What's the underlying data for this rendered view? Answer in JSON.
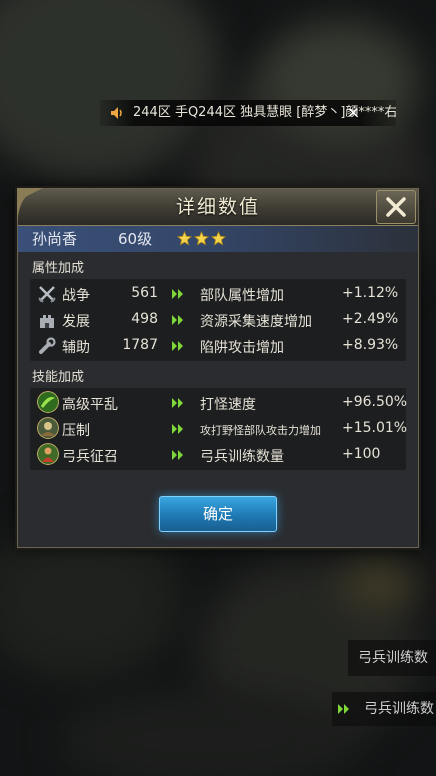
{
  "broadcast": {
    "message": "244区  手Q244区  独具慧眼  [醉梦丶]顔****右"
  },
  "dialog": {
    "title": "详细数值",
    "hero": {
      "name": "孙尚香",
      "level": "60级",
      "stars": 3
    },
    "attribute_section": {
      "title": "属性加成",
      "rows": [
        {
          "icon": "crossed-swords-icon",
          "name": "战争",
          "value": "561",
          "effect": "部队属性增加",
          "bonus": "+1.12%"
        },
        {
          "icon": "castle-icon",
          "name": "发展",
          "value": "498",
          "effect": "资源采集速度增加",
          "bonus": "+2.49%"
        },
        {
          "icon": "wrench-icon",
          "name": "辅助",
          "value": "1787",
          "effect": "陷阱攻击增加",
          "bonus": "+8.93%"
        }
      ]
    },
    "skill_section": {
      "title": "技能加成",
      "rows": [
        {
          "icon": "skill-advanced-rout-icon",
          "name": "高级平乱",
          "effect": "打怪速度",
          "bonus": "+96.50%"
        },
        {
          "icon": "skill-suppress-icon",
          "name": "压制",
          "effect": "攻打野怪部队攻击力增加",
          "bonus": "+15.01%"
        },
        {
          "icon": "skill-archer-recruit-icon",
          "name": "弓兵征召",
          "effect": "弓兵训练数量",
          "bonus": "+100"
        }
      ]
    },
    "confirm_label": "确定"
  },
  "background": {
    "row1": "弓兵训练数",
    "row2": "弓兵训练数"
  },
  "colors": {
    "accent_green": "#7fd83a",
    "hero_bar": "#3a5078",
    "button_blue": "#1f79b4",
    "star_gold": "#f4d24a"
  }
}
